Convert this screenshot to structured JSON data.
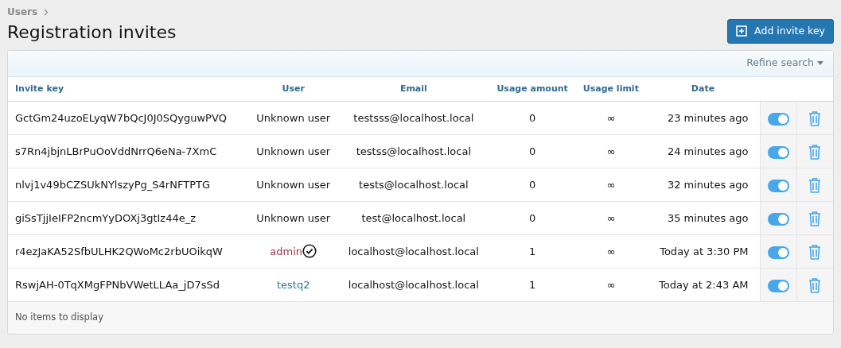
{
  "breadcrumb": [
    "Users"
  ],
  "title": "Registration invites",
  "add_button": {
    "label": "Add invite key"
  },
  "filter_bar": {
    "label": "Refine search"
  },
  "table": {
    "columns": [
      "Invite key",
      "User",
      "Email",
      "Usage amount",
      "Usage limit",
      "Date"
    ],
    "rows": [
      {
        "invite_key": "GctGm24uzoELyqW7bQcJ0J0SQyguwPVQ",
        "user": {
          "kind": "unknown",
          "name": "Unknown user"
        },
        "email": "testsss@localhost.local",
        "usage_amount": "0",
        "usage_limit": "∞",
        "date": "23 minutes ago",
        "enabled": true
      },
      {
        "invite_key": "s7Rn4jbjnLBrPuOoVddNrrQ6eNa-7XmC",
        "user": {
          "kind": "unknown",
          "name": "Unknown user"
        },
        "email": "testss@localhost.local",
        "usage_amount": "0",
        "usage_limit": "∞",
        "date": "24 minutes ago",
        "enabled": true
      },
      {
        "invite_key": "nlvj1v49bCZSUkNYlszyPg_S4rNFTPTG",
        "user": {
          "kind": "unknown",
          "name": "Unknown user"
        },
        "email": "tests@localhost.local",
        "usage_amount": "0",
        "usage_limit": "∞",
        "date": "32 minutes ago",
        "enabled": true
      },
      {
        "invite_key": "giSsTjjIeIFP2ncmYyDOXj3gtIz44e_z",
        "user": {
          "kind": "unknown",
          "name": "Unknown user"
        },
        "email": "test@localhost.local",
        "usage_amount": "0",
        "usage_limit": "∞",
        "date": "35 minutes ago",
        "enabled": true
      },
      {
        "invite_key": "r4ezJaKA52SfbULHK2QWoMc2rbUOikqW",
        "user": {
          "kind": "member",
          "name": "admin",
          "color": "#a0354b",
          "verified": true
        },
        "email": "localhost@localhost.local",
        "usage_amount": "1",
        "usage_limit": "∞",
        "date": "Today at 3:30 PM",
        "enabled": true
      },
      {
        "invite_key": "RswjAH-0TqXMgFPNbVWetLLAa_jD7sSd",
        "user": {
          "kind": "member",
          "name": "testq2",
          "color": "#2c7a9e",
          "verified": false
        },
        "email": "localhost@localhost.local",
        "usage_amount": "1",
        "usage_limit": "∞",
        "date": "Today at 2:43 AM",
        "enabled": true
      }
    ]
  },
  "footer": "No items to display"
}
